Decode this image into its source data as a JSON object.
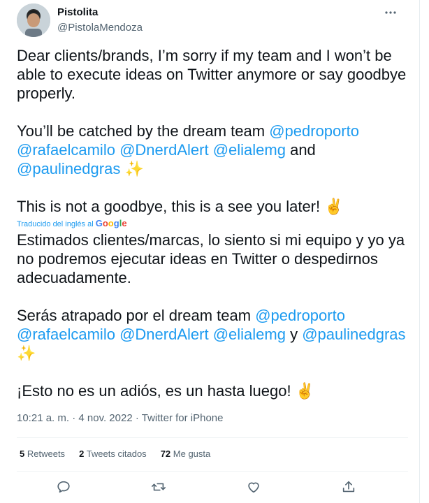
{
  "author": {
    "name": "Pistolita",
    "handle": "@PistolaMendoza"
  },
  "more_icon": "ellipsis-icon",
  "tweet": {
    "p1": "Dear clients/brands, I’m sorry if my team and I won’t be able to execute ideas on Twitter anymore or say goodbye properly.",
    "p2_intro": "You’ll be catched by the dream team",
    "p2_and": "and",
    "mentions_en": [
      "@pedroporto",
      "@rafaelcamilo",
      "@DnerdAlert",
      "@elialemg",
      "@paulinedgras"
    ],
    "sparkles": "✨",
    "p3": "This is not a goodbye, this is a see you later!",
    "victory": "✌️"
  },
  "translation": {
    "label": "Traducido del inglés al",
    "provider": "Google",
    "p1": "Estimados clientes/marcas, lo siento si mi equipo y yo ya no podremos ejecutar ideas en Twitter o despedirnos adecuadamente.",
    "p2_intro": "Serás atrapado por el dream team",
    "p2_and": "y",
    "p3": "¡Esto no es un adiós, es un hasta luego!"
  },
  "meta": {
    "time": "10:21 a. m.",
    "dot": "·",
    "date": "4 nov. 2022",
    "source": "Twitter for iPhone"
  },
  "stats": {
    "retweets_count": "5",
    "retweets_label": "Retweets",
    "quotes_count": "2",
    "quotes_label": "Tweets citados",
    "likes_count": "72",
    "likes_label": "Me gusta"
  },
  "actions": [
    "reply-icon",
    "retweet-icon",
    "like-icon",
    "share-icon"
  ],
  "colors": {
    "accent": "#1d9bf0",
    "secondary_text": "#536471",
    "text": "#0f1419"
  }
}
